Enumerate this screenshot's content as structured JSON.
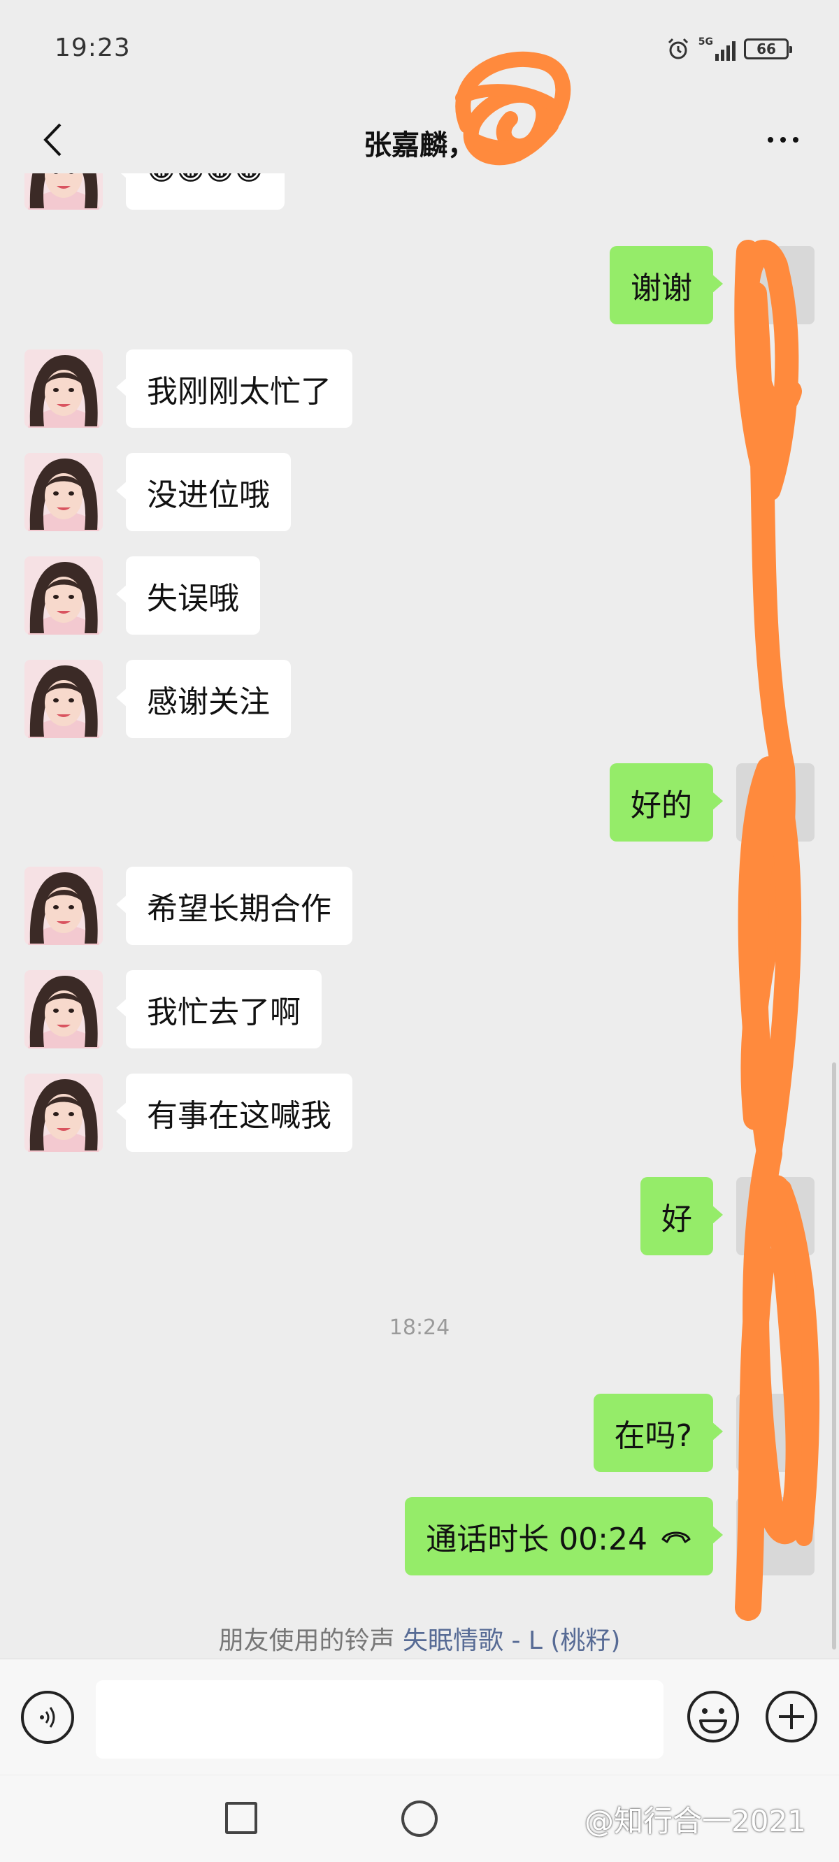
{
  "status_bar": {
    "time": "19:23",
    "network": "5G",
    "battery": "66"
  },
  "header": {
    "title": "张嘉麟，"
  },
  "messages": [
    {
      "side": "left",
      "text": "😁😁😁😁"
    },
    {
      "side": "right",
      "text": "谢谢"
    },
    {
      "side": "left",
      "text": "我刚刚太忙了"
    },
    {
      "side": "left",
      "text": "没进位哦"
    },
    {
      "side": "left",
      "text": "失误哦"
    },
    {
      "side": "left",
      "text": "感谢关注"
    },
    {
      "side": "right",
      "text": "好的"
    },
    {
      "side": "left",
      "text": "希望长期合作"
    },
    {
      "side": "left",
      "text": "我忙去了啊"
    },
    {
      "side": "left",
      "text": "有事在这喊我"
    },
    {
      "side": "right",
      "text": "好"
    },
    {
      "side": "right",
      "text": "在吗?"
    },
    {
      "side": "right",
      "text": "通话时长 00:24"
    }
  ],
  "timestamp": "18:24",
  "ringtone": {
    "prefix": "朋友使用的铃声",
    "song": "失眠情歌 - L (桃籽)"
  },
  "input": {
    "placeholder": ""
  },
  "watermark": "@知行合一2021",
  "colors": {
    "background": "#ededed",
    "bubble_sent": "#95ec69",
    "bubble_received": "#ffffff",
    "link": "#576b95",
    "redaction": "#ff8a3d"
  }
}
